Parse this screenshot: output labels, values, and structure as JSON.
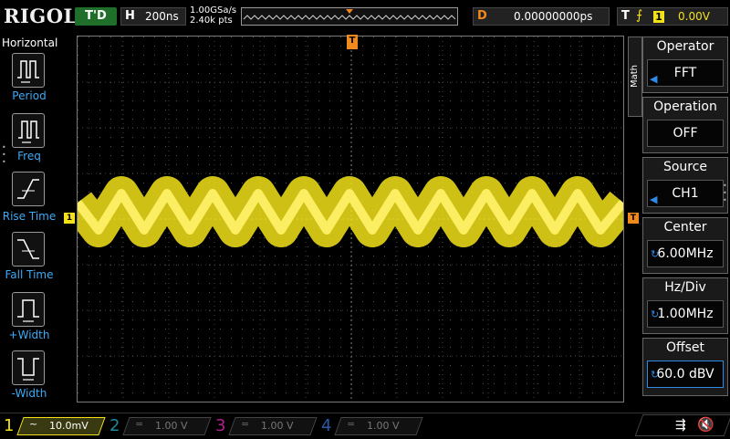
{
  "top": {
    "logo": "RIGOL",
    "trigger_status": "T'D",
    "horizontal_label": "H",
    "timebase": "200ns",
    "sample_rate": "1.00GSa/s",
    "memory_depth": "2.40k pts",
    "delay_label": "D",
    "delay_value": "0.00000000ps",
    "trigger_label": "T",
    "trigger_edge_icon": "rising-edge-icon",
    "trigger_source": "1",
    "trigger_level": "0.00V"
  },
  "left_panel": {
    "title": "Horizontal",
    "items": [
      {
        "label": "Period",
        "icon": "period-icon"
      },
      {
        "label": "Freq",
        "icon": "frequency-icon"
      },
      {
        "label": "Rise Time",
        "icon": "rise-time-icon"
      },
      {
        "label": "Fall Time",
        "icon": "fall-time-icon"
      },
      {
        "label": "+Width",
        "icon": "positive-width-icon"
      },
      {
        "label": "-Width",
        "icon": "negative-width-icon"
      }
    ]
  },
  "right_panel": {
    "tab": "Math",
    "operator": {
      "title": "Operator",
      "value": "FFT"
    },
    "operation": {
      "title": "Operation",
      "value": "OFF"
    },
    "source": {
      "title": "Source",
      "value": "CH1"
    },
    "center": {
      "title": "Center",
      "value": "6.00MHz"
    },
    "hzdiv": {
      "title": "Hz/Div",
      "value": "1.00MHz"
    },
    "offset": {
      "title": "Offset",
      "value": "60.0 dBV"
    }
  },
  "markers": {
    "ch1_marker": "1",
    "trigger_level_marker": "T",
    "trigger_position_marker": "T"
  },
  "channels": [
    {
      "num": "1",
      "coupling": "~",
      "scale": "10.0mV",
      "color": "#f3e21a"
    },
    {
      "num": "2",
      "coupling": "=",
      "scale": "1.00 V",
      "color": "#1f8a9a"
    },
    {
      "num": "3",
      "coupling": "=",
      "scale": "1.00 V",
      "color": "#b0208e"
    },
    {
      "num": "4",
      "coupling": "=",
      "scale": "1.00 V",
      "color": "#2a5aa6"
    }
  ],
  "colors": {
    "ch1": "#f3e21a",
    "trigger": "#f08a1c",
    "accent": "#2e8ae6",
    "menu_label": "#3fa9f5"
  },
  "status_icons": [
    "usb-icon",
    "speaker-muted-icon"
  ]
}
